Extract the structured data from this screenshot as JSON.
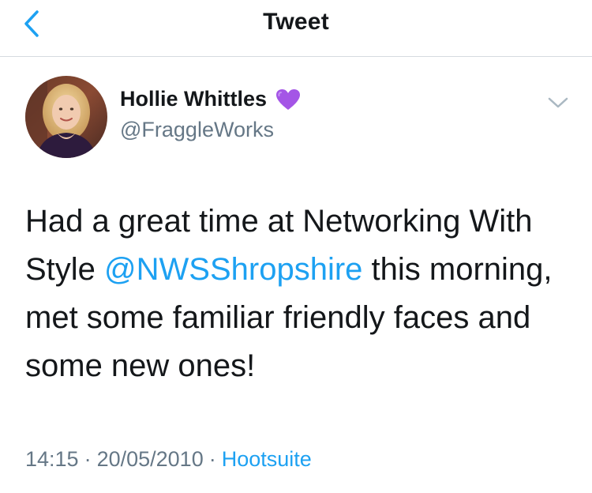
{
  "nav": {
    "title": "Tweet",
    "back_icon": "chevron-left-icon"
  },
  "tweet": {
    "author": {
      "display_name": "Hollie Whittles",
      "handle": "@FraggleWorks",
      "badge_icon": "purple-heart-icon"
    },
    "text_parts": {
      "before": "Had a great time at Networking With Style ",
      "mention": "@NWSShropshire",
      "after": " this morning, met some familiar friendly faces and some new ones!"
    },
    "meta": {
      "time": "14:15",
      "separator": "·",
      "date": "20/05/2010",
      "source": "Hootsuite"
    }
  },
  "colors": {
    "accent": "#1da1f2",
    "secondary_text": "#657786",
    "primary_text": "#14171a",
    "divider": "#d6dbe0",
    "heart": "#a455e6"
  }
}
